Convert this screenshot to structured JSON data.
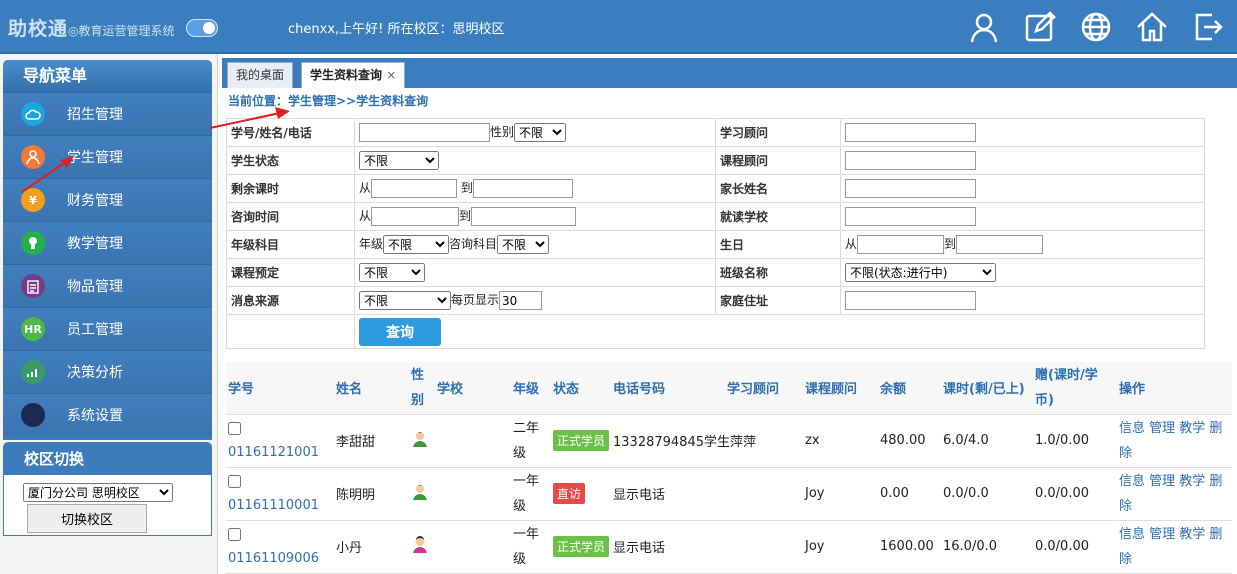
{
  "app": {
    "logo": "助校通",
    "logo_sub": "◎教育运营管理系统",
    "greeting": "chenxx,上午好! 所在校区：思明校区"
  },
  "toolbar_icons": [
    "user-icon",
    "edit-icon",
    "globe-icon",
    "home-icon",
    "logout-icon"
  ],
  "nav": {
    "title": "导航菜单",
    "items": [
      {
        "label": "招生管理",
        "icon": "cloud-icon",
        "color": "#1aa6e0"
      },
      {
        "label": "学生管理",
        "icon": "person-icon",
        "color": "#f07a3a"
      },
      {
        "label": "财务管理",
        "icon": "yen-icon",
        "color": "#f0a020"
      },
      {
        "label": "教学管理",
        "icon": "bulb-icon",
        "color": "#22b04a"
      },
      {
        "label": "物品管理",
        "icon": "clipboard-icon",
        "color": "#7a3a8a"
      },
      {
        "label": "员工管理",
        "icon": "hr-icon",
        "color": "#4cb848"
      },
      {
        "label": "决策分析",
        "icon": "chart-icon",
        "color": "#3a9a6a"
      },
      {
        "label": "系统设置",
        "icon": "moon-icon",
        "color": "#1a2a50"
      }
    ]
  },
  "campus": {
    "title": "校区切换",
    "selected": "厦门分公司 思明校区",
    "button": "切换校区"
  },
  "tabs": [
    {
      "label": "我的桌面"
    },
    {
      "label": "学生资料查询",
      "close": "×"
    }
  ],
  "breadcrumb": "当前位置：学生管理>>学生资料查询",
  "filters": {
    "id_label": "学号/姓名/电话",
    "gender_label": "性别",
    "gender_value": "不限",
    "advisor_label": "学习顾问",
    "status_label": "学生状态",
    "status_value": "不限",
    "course_advisor_label": "课程顾问",
    "remain_label": "剩余课时",
    "from": "从",
    "to": "到",
    "parent_label": "家长姓名",
    "consult_label": "咨询时间",
    "school_label": "就读学校",
    "grade_subject_label": "年级科目",
    "grade_label": "年级",
    "grade_value": "不限",
    "subject_label": "咨询科目",
    "subject_value": "不限",
    "birthday_label": "生日",
    "reserve_label": "课程预定",
    "reserve_value": "不限",
    "class_label": "班级名称",
    "class_value": "不限(状态:进行中)",
    "source_label": "消息来源",
    "source_value": "不限",
    "perpage_label": "每页显示",
    "perpage_value": "30",
    "address_label": "家庭住址",
    "query_button": "查询"
  },
  "table": {
    "headers": {
      "id": "学号",
      "name": "姓名",
      "gender": "性别",
      "school": "学校",
      "grade": "年级",
      "status": "状态",
      "phone": "电话号码",
      "advisor": "学习顾问",
      "course_advisor": "课程顾问",
      "balance": "余额",
      "hours": "课时(剩/已上)",
      "gift": "赠(课时/学币)",
      "ops": "操作"
    },
    "ops_labels": "信息 管理 教学 删除",
    "rows": [
      {
        "id": "01161121001",
        "name": "李甜甜",
        "grade": "二年级",
        "status": "正式学员",
        "status_color": "#6cc04a",
        "phone": "13328794845",
        "advisor": "学生萍萍",
        "course_advisor": "zx",
        "balance": "480.00",
        "hours": "6.0/4.0",
        "gift": "1.0/0.00",
        "avatar": "male-avatar-icon"
      },
      {
        "id": "01161110001",
        "name": "陈明明",
        "grade": "一年级",
        "status": "直访",
        "status_color": "#e84a4a",
        "phone": "显示电话",
        "advisor": "",
        "course_advisor": "Joy",
        "balance": "0.00",
        "hours": "0.0/0.0",
        "gift": "0.0/0.00",
        "avatar": "male-avatar-icon"
      },
      {
        "id": "01161109006",
        "name": "小丹",
        "grade": "一年级",
        "status": "正式学员",
        "status_color": "#6cc04a",
        "phone": "显示电话",
        "advisor": "",
        "course_advisor": "Joy",
        "balance": "1600.00",
        "hours": "16.0/0.0",
        "gift": "0.0/0.00",
        "avatar": "female-avatar-icon"
      }
    ]
  }
}
